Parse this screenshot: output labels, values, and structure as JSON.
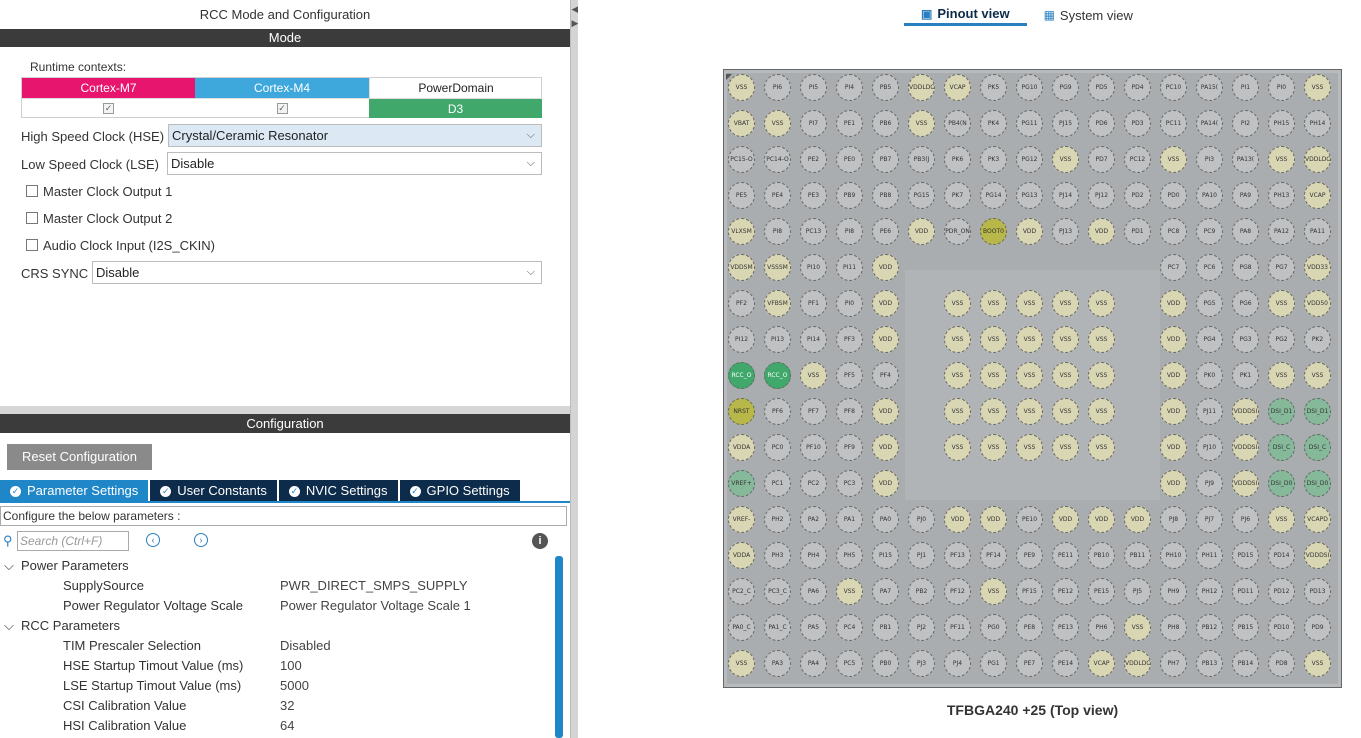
{
  "left": {
    "title": "RCC Mode and Configuration",
    "mode_bar": "Mode",
    "runtime_label": "Runtime contexts:",
    "contexts": [
      {
        "label": "Cortex-M7",
        "color": "#e8156e"
      },
      {
        "label": "Cortex-M4",
        "color": "#3ea8dc"
      },
      {
        "label": "PowerDomain",
        "value": "D3",
        "value_color": "#3fa86a"
      }
    ],
    "hse_label": "High Speed Clock (HSE)",
    "hse_value": "Crystal/Ceramic Resonator",
    "lse_label": "Low Speed Clock (LSE)",
    "lse_value": "Disable",
    "checks": [
      "Master Clock Output 1",
      "Master Clock Output 2",
      "Audio Clock Input (I2S_CKIN)"
    ],
    "crs_label": "CRS SYNC",
    "crs_value": "Disable",
    "config_bar": "Configuration",
    "reset_label": "Reset Configuration",
    "tabs": [
      "Parameter Settings",
      "User Constants",
      "NVIC Settings",
      "GPIO Settings"
    ],
    "configure_text": "Configure the below parameters :",
    "search_placeholder": "Search (Ctrl+F)",
    "tree": [
      {
        "group": "Power Parameters",
        "items": [
          {
            "name": "SupplySource",
            "value": "PWR_DIRECT_SMPS_SUPPLY"
          },
          {
            "name": "Power Regulator Voltage Scale",
            "value": "Power Regulator Voltage Scale 1"
          }
        ]
      },
      {
        "group": "RCC Parameters",
        "items": [
          {
            "name": "TIM Prescaler Selection",
            "value": "Disabled"
          },
          {
            "name": "HSE Startup Timout Value (ms)",
            "value": "100"
          },
          {
            "name": "LSE Startup Timout Value (ms)",
            "value": "5000"
          },
          {
            "name": "CSI Calibration Value",
            "value": "32"
          },
          {
            "name": "HSI Calibration Value",
            "value": "64"
          }
        ]
      }
    ]
  },
  "right": {
    "tabs": [
      "Pinout view",
      "System view"
    ],
    "chip_caption": "TFBGA240 +25 (Top view)",
    "pins": [
      [
        "VSS",
        "PI6",
        "PI5",
        "PI4",
        "PB5",
        "VDDLDO",
        "VCAP",
        "PK5",
        "PG10",
        "PG9",
        "PD5",
        "PD4",
        "PC10",
        "PA15(",
        "PI1",
        "PI0",
        "VSS"
      ],
      [
        "VBAT",
        "VSS",
        "PI7",
        "PE1",
        "PB6",
        "VSS",
        "PB4(N",
        "PK4",
        "PG11",
        "PJ15",
        "PD6",
        "PD3",
        "PC11",
        "PA14(",
        "PI2",
        "PH15",
        "PH14"
      ],
      [
        "PC15-O",
        "PC14-O",
        "PE2",
        "PE0",
        "PB7",
        "PB3(J",
        "PK6",
        "PK3",
        "PG12",
        "VSS",
        "PD7",
        "PC12",
        "VSS",
        "PI3",
        "PA13(",
        "VSS",
        "VDDLDO"
      ],
      [
        "PE5",
        "PE4",
        "PE3",
        "PB9",
        "PB8",
        "PG15",
        "PK7",
        "PG14",
        "PG13",
        "PJ14",
        "PJ12",
        "PD2",
        "PD0",
        "PA10",
        "PA9",
        "PH13",
        "VCAP"
      ],
      [
        "VLXSM",
        "PI8",
        "PC13",
        "PI8",
        "PE6",
        "VDD",
        "PDR_ON",
        "BOOT0",
        "VDD",
        "PJ13",
        "VDD",
        "PD1",
        "PC8",
        "PC9",
        "PA8",
        "PA12",
        "PA11"
      ],
      [
        "VDDSM",
        "VSSSM",
        "PI10",
        "PI11",
        "VDD",
        "",
        "",
        "",
        "",
        "",
        "",
        "",
        "PC7",
        "PC6",
        "PG8",
        "PG7",
        "VDD33"
      ],
      [
        "PF2",
        "VFBSM",
        "PF1",
        "PI0",
        "VDD",
        "",
        "VSS",
        "VSS",
        "VSS",
        "VSS",
        "VSS",
        "",
        "VDD",
        "PG5",
        "PG6",
        "VSS",
        "VDD50"
      ],
      [
        "PI12",
        "PI13",
        "PI14",
        "PF3",
        "VDD",
        "",
        "VSS",
        "VSS",
        "VSS",
        "VSS",
        "VSS",
        "",
        "VDD",
        "PG4",
        "PG3",
        "PG2",
        "PK2"
      ],
      [
        "RCC_O",
        "RCC_O",
        "VSS",
        "PF5",
        "PF4",
        "",
        "VSS",
        "VSS",
        "VSS",
        "VSS",
        "VSS",
        "",
        "VDD",
        "PK0",
        "PK1",
        "VSS",
        "VSS"
      ],
      [
        "NRST",
        "PF6",
        "PF7",
        "PF8",
        "VDD",
        "",
        "VSS",
        "VSS",
        "VSS",
        "VSS",
        "VSS",
        "",
        "VDD",
        "PJ11",
        "VDDDSI",
        "DSI_D1",
        "DSI_D1"
      ],
      [
        "VDDA",
        "PC0",
        "PF10",
        "PF9",
        "VDD",
        "",
        "VSS",
        "VSS",
        "VSS",
        "VSS",
        "VSS",
        "",
        "VDD",
        "PJ10",
        "VDDDSI",
        "DSI_C",
        "DSI_C"
      ],
      [
        "VREF+",
        "PC1",
        "PC2",
        "PC3",
        "VDD",
        "",
        "",
        "",
        "",
        "",
        "",
        "",
        "VDD",
        "PJ9",
        "VDDDSI",
        "DSI_D0",
        "DSI_D0"
      ],
      [
        "VREF-",
        "PH2",
        "PA2",
        "PA1",
        "PA0",
        "PJ0",
        "VDD",
        "VDD",
        "PE10",
        "VDD",
        "VDD",
        "VDD",
        "PJ8",
        "PJ7",
        "PJ6",
        "VSS",
        "VCAPD"
      ],
      [
        "VDDA",
        "PH3",
        "PH4",
        "PH5",
        "PI15",
        "PJ1",
        "PF13",
        "PF14",
        "PE9",
        "PE11",
        "PB10",
        "PB11",
        "PH10",
        "PH11",
        "PD15",
        "PD14",
        "VDDDSI"
      ],
      [
        "PC2_C",
        "PC3_C",
        "PA6",
        "VSS",
        "PA7",
        "PB2",
        "PF12",
        "VSS",
        "PF15",
        "PE12",
        "PE15",
        "PJ5",
        "PH9",
        "PH12",
        "PD11",
        "PD12",
        "PD13"
      ],
      [
        "PA0_C",
        "PA1_C",
        "PA5",
        "PC4",
        "PB1",
        "PJ2",
        "PF11",
        "PG0",
        "PE8",
        "PE13",
        "PH6",
        "VSS",
        "PH8",
        "PB12",
        "PB15",
        "PD10",
        "PD9"
      ],
      [
        "VSS",
        "PA3",
        "PA4",
        "PC5",
        "PB0",
        "PJ3",
        "PJ4",
        "PG1",
        "PE7",
        "PE14",
        "VCAP",
        "VDDLDO",
        "PH7",
        "PB13",
        "PB14",
        "PD8",
        "VSS"
      ]
    ]
  }
}
